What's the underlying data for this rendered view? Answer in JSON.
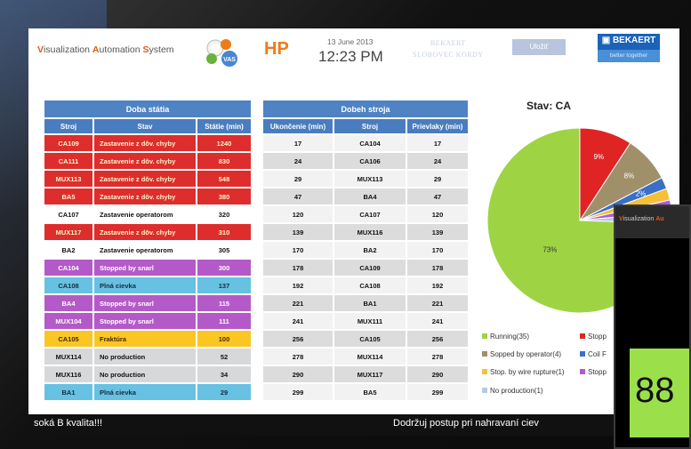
{
  "header": {
    "brand": {
      "v": "V",
      "v_rest": "isualization ",
      "a": "A",
      "a_rest": "utomation ",
      "s": "S",
      "s_rest": "ystem"
    },
    "vas_label": "VAS",
    "code": "HP",
    "date": "13 June 2013",
    "time": "12:23 PM",
    "ghost_line1": "BEKAERT",
    "ghost_line2": "SLOBOVEC KORDY",
    "save_label": "Uložiť",
    "bekaert_name": "▣ BEKAERT",
    "bekaert_tagline": "better together"
  },
  "downtime_table": {
    "caption": "Doba státia",
    "columns": [
      "Stroj",
      "Stav",
      "Státie (min)"
    ],
    "rows": [
      {
        "style": "red",
        "cells": [
          "CA109",
          "Zastavenie z dôv. chyby",
          "1240"
        ]
      },
      {
        "style": "red",
        "cells": [
          "CA111",
          "Zastavenie z dôv. chyby",
          "830"
        ]
      },
      {
        "style": "red",
        "cells": [
          "MUX113",
          "Zastavenie z dôv. chyby",
          "548"
        ]
      },
      {
        "style": "red",
        "cells": [
          "BA5",
          "Zastavenie z dôv. chyby",
          "380"
        ]
      },
      {
        "style": "white",
        "cells": [
          "CA107",
          "Zastavenie operatorom",
          "320"
        ]
      },
      {
        "style": "red",
        "cells": [
          "MUX117",
          "Zastavenie z dôv. chyby",
          "310"
        ]
      },
      {
        "style": "white",
        "cells": [
          "BA2",
          "Zastavenie operatorom",
          "305"
        ]
      },
      {
        "style": "purple",
        "cells": [
          "CA104",
          "Stopped by snarl",
          "300"
        ]
      },
      {
        "style": "cyan",
        "cells": [
          "CA108",
          "Plná cievka",
          "137"
        ]
      },
      {
        "style": "purple",
        "cells": [
          "BA4",
          "Stopped by snarl",
          "115"
        ]
      },
      {
        "style": "purple",
        "cells": [
          "MUX104",
          "Stopped by snarl",
          "111"
        ]
      },
      {
        "style": "yellow",
        "cells": [
          "CA105",
          "Fraktúra",
          "100"
        ]
      },
      {
        "style": "grey",
        "cells": [
          "MUX114",
          "No production",
          "52"
        ]
      },
      {
        "style": "grey",
        "cells": [
          "MUX116",
          "No production",
          "34"
        ]
      },
      {
        "style": "cyan",
        "cells": [
          "BA1",
          "Plná cievka",
          "29"
        ]
      }
    ]
  },
  "runtime_table": {
    "caption": "Dobeh stroja",
    "columns": [
      "Ukončenie (min)",
      "Stroj",
      "Prievlaky (min)"
    ],
    "rows": [
      [
        "17",
        "CA104",
        "17"
      ],
      [
        "24",
        "CA106",
        "24"
      ],
      [
        "29",
        "MUX113",
        "29"
      ],
      [
        "47",
        "BA4",
        "47"
      ],
      [
        "120",
        "CA107",
        "120"
      ],
      [
        "139",
        "MUX116",
        "139"
      ],
      [
        "170",
        "BA2",
        "170"
      ],
      [
        "178",
        "CA109",
        "178"
      ],
      [
        "192",
        "CA108",
        "192"
      ],
      [
        "221",
        "BA1",
        "221"
      ],
      [
        "241",
        "MUX111",
        "241"
      ],
      [
        "256",
        "CA105",
        "256"
      ],
      [
        "278",
        "MUX114",
        "278"
      ],
      [
        "290",
        "MUX117",
        "290"
      ],
      [
        "299",
        "BA5",
        "299"
      ]
    ]
  },
  "chart_data": {
    "type": "pie",
    "title": "Stav: CA",
    "slices": [
      {
        "label": "Running(35)",
        "value": 73,
        "display": "73%",
        "color": "#9ed444"
      },
      {
        "label": "Stopp",
        "value": 9,
        "display": "9%",
        "color": "#e02424"
      },
      {
        "label": "Sopped by operator(4)",
        "value": 8,
        "display": "8%",
        "color": "#a0906a"
      },
      {
        "label": "Coil F",
        "value": 2,
        "display": "2%",
        "color": "#3a6fc8"
      },
      {
        "label": "Stop. by wire rupture(1)",
        "value": 2,
        "display": "",
        "color": "#f5c038"
      },
      {
        "label": "Stopp",
        "value": 2,
        "display": "",
        "color": "#b05ad0"
      },
      {
        "label": "No production(1)",
        "value": 2,
        "display": "",
        "color": "#b8c8e8"
      }
    ]
  },
  "legend": [
    {
      "label": "Running(35)",
      "color": "#9ed444"
    },
    {
      "label": "Stopp",
      "color": "#e02424"
    },
    {
      "label": "Sopped by operator(4)",
      "color": "#a0906a"
    },
    {
      "label": "Coil F",
      "color": "#3a6fc8"
    },
    {
      "label": "Stop. by wire rupture(1)",
      "color": "#f5c038"
    },
    {
      "label": "Stopp",
      "color": "#b05ad0"
    },
    {
      "label": "No production(1)",
      "color": "#b8c8e8"
    }
  ],
  "ticker": {
    "left": "soká B kvalita!!!",
    "right": "Dodržuj postup pri nahravaní ciev"
  },
  "overlay": {
    "brand": {
      "v": "V",
      "v_rest": "isualization ",
      "a": "Au"
    },
    "number": "88"
  }
}
